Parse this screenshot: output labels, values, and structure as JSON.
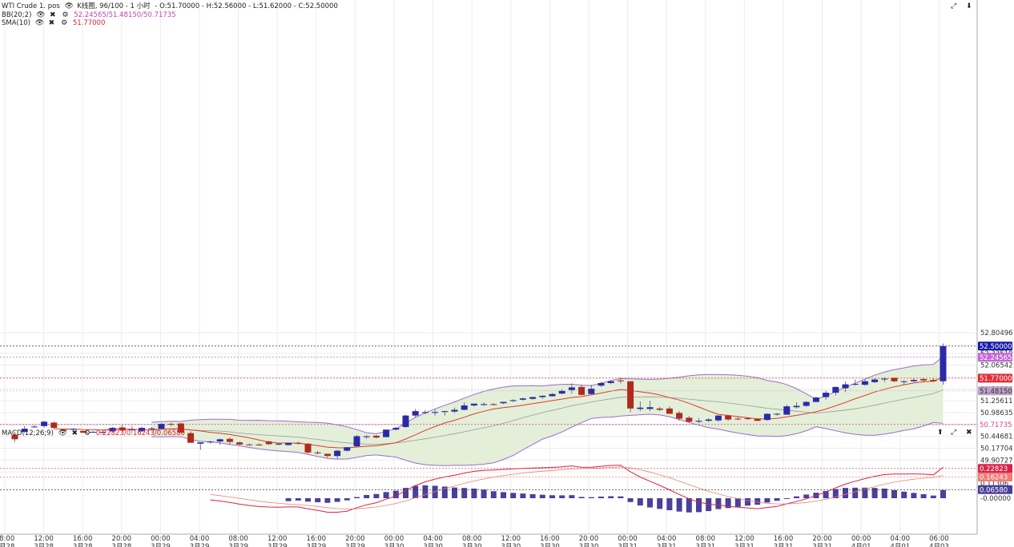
{
  "header": {
    "symbol": "WTI Crude 1. pos",
    "period": "K线图, 96/100 - 1 小时",
    "ohlc": "- O:51.70000 - H:52.56000 - L:51.62000 - C:52.50000",
    "bb_label": "BB(20;2)",
    "bb_values": "52.24565/51.48150/50.71735",
    "sma_label": "SMA(10)",
    "sma_value": "51.77000",
    "macd_label": "MACD(12;26;9)",
    "macd_values": "0.22823/0.16243/0.06580"
  },
  "colors": {
    "up": "#2a2aa8",
    "down": "#b02a1e",
    "bb_band": "#9b6ccf",
    "bb_fill": "#e3efd9",
    "bb_mid": "#9a9a9a",
    "sma": "#e03a2a",
    "macd_line": "#d8234a",
    "signal_line": "#f08070",
    "histogram": "#4a3f9a",
    "last_price_tag": "#1a1aa8",
    "bb_upper_tag": "#c466d8",
    "sma_tag": "#e0303a",
    "bb_mid_tag": "#c0a0c8",
    "bb_lower_tag": "#d0448a"
  },
  "icons": [
    "eye-icon",
    "close-icon",
    "gear-icon",
    "expand-icon",
    "scroll-down-icon",
    "up-arrow-icon"
  ],
  "price_axis": {
    "ticks": [
      "52.80496",
      "52.33519",
      "52.06542",
      "51.79566",
      "51.52588",
      "51.25611",
      "50.98635",
      "50.44681",
      "50.17704",
      "49.90727",
      "49.63750"
    ],
    "tags": {
      "last": "52.50000",
      "bb_upper": "52.24565",
      "sma": "51.77000",
      "bb_mid": "51.48150",
      "bb_lower": "50.71735"
    }
  },
  "macd_axis": {
    "ticks": [
      "0.11306",
      "-0.00000"
    ],
    "tags": {
      "macd": "0.22823",
      "signal": "0.16243",
      "hist": "0.06580"
    }
  },
  "time_axis": [
    {
      "t": "08:00",
      "d": "3月28"
    },
    {
      "t": "12:00",
      "d": "3月28"
    },
    {
      "t": "16:00",
      "d": "3月28"
    },
    {
      "t": "20:00",
      "d": "3月28"
    },
    {
      "t": "00:00",
      "d": "3月29"
    },
    {
      "t": "04:00",
      "d": "3月29"
    },
    {
      "t": "08:00",
      "d": "3月29"
    },
    {
      "t": "12:00",
      "d": "3月29"
    },
    {
      "t": "16:00",
      "d": "3月29"
    },
    {
      "t": "20:00",
      "d": "3月29"
    },
    {
      "t": "00:00",
      "d": "3月30"
    },
    {
      "t": "04:00",
      "d": "3月30"
    },
    {
      "t": "08:00",
      "d": "3月30"
    },
    {
      "t": "12:00",
      "d": "3月30"
    },
    {
      "t": "16:00",
      "d": "3月30"
    },
    {
      "t": "20:00",
      "d": "3月30"
    },
    {
      "t": "00:00",
      "d": "3月31"
    },
    {
      "t": "04:00",
      "d": "3月31"
    },
    {
      "t": "08:00",
      "d": "3月31"
    },
    {
      "t": "12:00",
      "d": "3月31"
    },
    {
      "t": "16:00",
      "d": "3月31"
    },
    {
      "t": "20:00",
      "d": "3月31"
    },
    {
      "t": "00:00",
      "d": "4月01"
    },
    {
      "t": "04:00",
      "d": "4月01"
    },
    {
      "t": "06:00",
      "d": "4月03"
    }
  ],
  "chart_data": {
    "type": "candlestick",
    "candles": [
      [
        50.48,
        50.55,
        50.32,
        50.38
      ],
      [
        50.55,
        50.68,
        50.52,
        50.62
      ],
      [
        50.66,
        50.7,
        50.64,
        50.67
      ],
      [
        50.68,
        50.8,
        50.65,
        50.78
      ],
      [
        50.76,
        50.78,
        50.62,
        50.64
      ],
      [
        50.6,
        50.62,
        50.57,
        50.58
      ],
      [
        50.6,
        50.63,
        50.57,
        50.62
      ],
      [
        50.57,
        50.58,
        50.52,
        50.53
      ],
      [
        50.54,
        50.57,
        50.53,
        50.55
      ],
      [
        50.54,
        50.58,
        50.5,
        50.55
      ],
      [
        50.56,
        50.66,
        50.54,
        50.64
      ],
      [
        50.65,
        50.7,
        50.56,
        50.58
      ],
      [
        50.59,
        50.68,
        50.52,
        50.61
      ],
      [
        50.56,
        50.66,
        50.55,
        50.64
      ],
      [
        50.62,
        50.66,
        50.58,
        50.63
      ],
      [
        50.62,
        50.75,
        50.6,
        50.73
      ],
      [
        50.73,
        50.76,
        50.68,
        50.72
      ],
      [
        50.74,
        50.75,
        50.55,
        50.53
      ],
      [
        50.52,
        50.56,
        50.33,
        50.3
      ],
      [
        50.28,
        50.3,
        50.14,
        50.31
      ],
      [
        50.31,
        50.34,
        50.28,
        50.33
      ],
      [
        50.33,
        50.4,
        50.25,
        50.38
      ],
      [
        50.39,
        50.42,
        50.25,
        50.32
      ],
      [
        50.31,
        50.33,
        50.25,
        50.26
      ],
      [
        50.26,
        50.29,
        50.25,
        50.25
      ],
      [
        50.26,
        50.29,
        50.25,
        50.24
      ],
      [
        50.33,
        50.35,
        50.25,
        50.27
      ],
      [
        50.26,
        50.29,
        50.24,
        50.28
      ],
      [
        50.25,
        50.3,
        50.24,
        50.3
      ],
      [
        50.3,
        50.32,
        50.26,
        50.28
      ],
      [
        50.28,
        50.29,
        50.05,
        50.08
      ],
      [
        50.08,
        50.12,
        50.04,
        50.06
      ],
      [
        50.05,
        50.05,
        49.96,
        50.0
      ],
      [
        50.0,
        50.14,
        49.94,
        50.12
      ],
      [
        50.12,
        50.17,
        50.1,
        50.2
      ],
      [
        50.22,
        50.48,
        50.2,
        50.45
      ],
      [
        50.43,
        50.47,
        50.39,
        50.45
      ],
      [
        50.46,
        50.48,
        50.4,
        50.42
      ],
      [
        50.43,
        50.6,
        50.42,
        50.6
      ],
      [
        50.6,
        50.66,
        50.58,
        50.64
      ],
      [
        50.66,
        50.94,
        50.64,
        50.92
      ],
      [
        50.92,
        51.07,
        50.88,
        51.02
      ],
      [
        50.98,
        51.05,
        50.95,
        51.0
      ],
      [
        50.98,
        51.06,
        50.92,
        51.0
      ],
      [
        51.0,
        51.03,
        50.92,
        51.02
      ],
      [
        51.01,
        51.1,
        50.98,
        51.05
      ],
      [
        51.05,
        51.22,
        51.04,
        51.15
      ],
      [
        51.15,
        51.19,
        51.12,
        51.19
      ],
      [
        51.16,
        51.22,
        51.14,
        51.18
      ],
      [
        51.18,
        51.2,
        51.15,
        51.16
      ],
      [
        51.2,
        51.23,
        51.18,
        51.23
      ],
      [
        51.25,
        51.29,
        51.23,
        51.27
      ],
      [
        51.28,
        51.33,
        51.26,
        51.31
      ],
      [
        51.3,
        51.35,
        51.28,
        51.34
      ],
      [
        51.34,
        51.38,
        51.3,
        51.37
      ],
      [
        51.36,
        51.43,
        51.35,
        51.41
      ],
      [
        51.42,
        51.52,
        51.4,
        51.48
      ],
      [
        51.5,
        51.65,
        51.42,
        51.56
      ],
      [
        51.57,
        51.62,
        51.38,
        51.39
      ],
      [
        51.41,
        51.62,
        51.39,
        51.53
      ],
      [
        51.6,
        51.69,
        51.57,
        51.66
      ],
      [
        51.66,
        51.72,
        51.63,
        51.7
      ],
      [
        51.72,
        51.78,
        51.65,
        51.7
      ],
      [
        51.7,
        51.7,
        51.0,
        51.08
      ],
      [
        51.07,
        51.24,
        51.02,
        51.1
      ],
      [
        51.07,
        51.26,
        51.02,
        51.11
      ],
      [
        51.08,
        51.12,
        51.02,
        51.05
      ],
      [
        51.08,
        51.13,
        50.96,
        50.96
      ],
      [
        50.98,
        51.02,
        50.8,
        50.85
      ],
      [
        50.87,
        50.91,
        50.75,
        50.78
      ],
      [
        50.78,
        50.86,
        50.75,
        50.8
      ],
      [
        50.8,
        50.86,
        50.78,
        50.83
      ],
      [
        50.81,
        50.89,
        50.78,
        50.92
      ],
      [
        50.92,
        50.93,
        50.8,
        50.83
      ],
      [
        50.85,
        50.89,
        50.82,
        50.84
      ],
      [
        50.86,
        50.87,
        50.82,
        50.84
      ],
      [
        50.84,
        50.86,
        50.79,
        50.8
      ],
      [
        50.82,
        50.97,
        50.8,
        50.96
      ],
      [
        50.95,
        50.98,
        50.92,
        50.96
      ],
      [
        50.94,
        51.17,
        50.94,
        51.13
      ],
      [
        51.11,
        51.22,
        51.08,
        51.14
      ],
      [
        51.14,
        51.25,
        51.12,
        51.23
      ],
      [
        51.23,
        51.35,
        51.22,
        51.33
      ],
      [
        51.34,
        51.49,
        51.28,
        51.44
      ],
      [
        51.44,
        51.58,
        51.38,
        51.57
      ],
      [
        51.54,
        51.7,
        51.45,
        51.63
      ],
      [
        51.64,
        51.74,
        51.6,
        51.64
      ],
      [
        51.62,
        51.74,
        51.6,
        51.7
      ],
      [
        51.68,
        51.77,
        51.66,
        51.74
      ],
      [
        51.74,
        51.79,
        51.68,
        51.76
      ],
      [
        51.78,
        51.78,
        51.68,
        51.7
      ],
      [
        51.69,
        51.72,
        51.62,
        51.7
      ],
      [
        51.7,
        51.77,
        51.68,
        51.73
      ],
      [
        51.75,
        51.78,
        51.68,
        51.72
      ],
      [
        51.73,
        51.77,
        51.68,
        51.7
      ],
      [
        51.7,
        52.56,
        51.62,
        52.5
      ]
    ],
    "bb_upper_tag": 52.24565,
    "bb_mid_tag": 51.4815,
    "bb_lower_tag": 50.71735,
    "sma_tag": 51.77,
    "macd": {
      "macd": 0.22823,
      "signal": 0.16243,
      "hist": 0.0658
    }
  }
}
